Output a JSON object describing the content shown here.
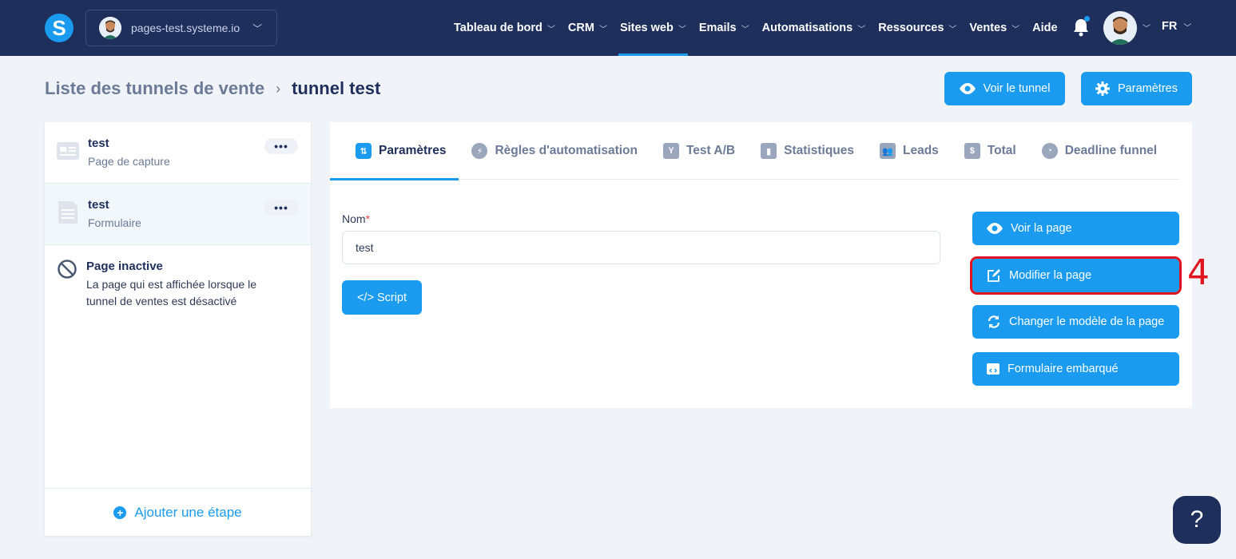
{
  "topbar": {
    "logo": "S",
    "site": "pages-test.systeme.io",
    "nav": [
      {
        "label": "Tableau de bord"
      },
      {
        "label": "CRM"
      },
      {
        "label": "Sites web"
      },
      {
        "label": "Emails"
      },
      {
        "label": "Automatisations"
      },
      {
        "label": "Ressources"
      },
      {
        "label": "Ventes"
      },
      {
        "label": "Aide"
      }
    ],
    "active_nav": "Sites web",
    "language": "FR"
  },
  "header": {
    "breadcrumb_parent": "Liste des tunnels de vente",
    "breadcrumb_sep": "›",
    "breadcrumb_current": "tunnel test",
    "btn_voir_tunnel": "Voir le tunnel",
    "btn_parametres": "Paramètres"
  },
  "sidebar": {
    "steps": [
      {
        "title": "test",
        "subtitle": "Page de capture",
        "more": "•••"
      },
      {
        "title": "test",
        "subtitle": "Formulaire",
        "more": "•••"
      }
    ],
    "inactive_title": "Page inactive",
    "inactive_desc": "La page qui est affichée lorsque le tunnel de ventes est désactivé",
    "add_step": "Ajouter une étape"
  },
  "tabs": [
    {
      "label": "Paramètres"
    },
    {
      "label": "Règles d'automatisation"
    },
    {
      "label": "Test A/B"
    },
    {
      "label": "Statistiques"
    },
    {
      "label": "Leads"
    },
    {
      "label": "Total"
    },
    {
      "label": "Deadline funnel"
    }
  ],
  "form": {
    "name_label": "Nom",
    "required_mark": "*",
    "name_value": "test",
    "script_button": "</> Script"
  },
  "actions": {
    "voir_page": "Voir la page",
    "modifier_page": "Modifier la page",
    "changer_modele": "Changer le modèle de la page",
    "formulaire_embarque": "Formulaire embarqué"
  },
  "annotation": "4",
  "help": "?",
  "colors": {
    "topbar": "#1e2f5c",
    "accent": "#1a9bf0",
    "highlight": "#e0141e"
  }
}
